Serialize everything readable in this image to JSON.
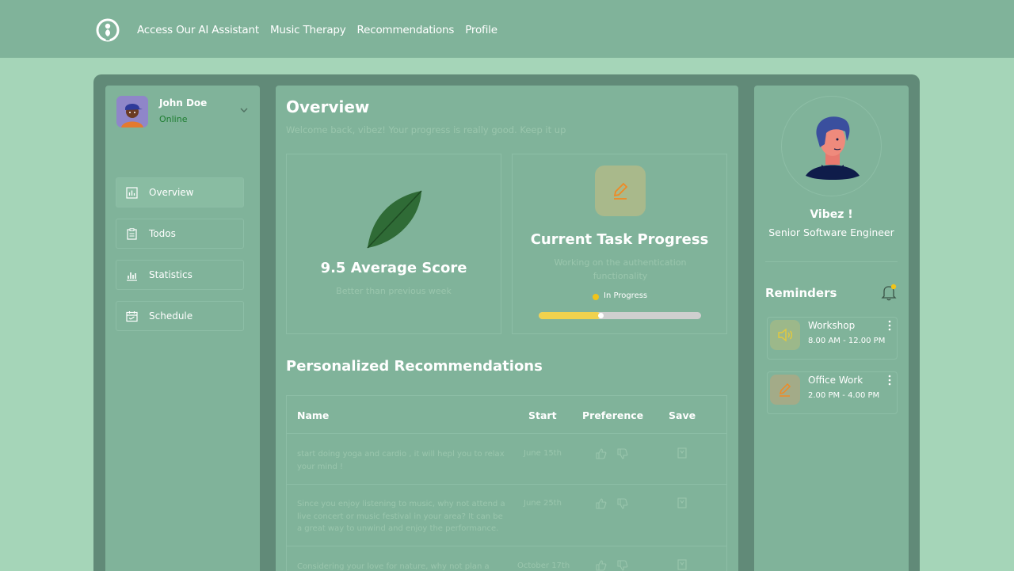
{
  "nav": {
    "logo_icon": "head-leaf-logo-icon",
    "links": [
      "Access Our AI Assistant",
      "Music Therapy",
      "Recommendations",
      "Profile"
    ]
  },
  "user": {
    "name": "John Doe",
    "status": "Online",
    "status_color": "#1e7d30"
  },
  "sidebar": {
    "items": [
      {
        "label": "Overview",
        "icon": "bar-chart-icon",
        "active": true
      },
      {
        "label": "Todos",
        "icon": "clipboard-icon",
        "active": false
      },
      {
        "label": "Statistics",
        "icon": "statistics-icon",
        "active": false
      },
      {
        "label": "Schedule",
        "icon": "calendar-icon",
        "active": false
      }
    ]
  },
  "overview": {
    "title": "Overview",
    "welcome": "Welcome back, vibez! Your progress is really good. Keep it up"
  },
  "score_card": {
    "title": "9.5 Average Score",
    "subtitle": "Better than previous week"
  },
  "task_card": {
    "title": "Current Task Progress",
    "subtitle": "Working on the authentication functionality",
    "status": "In Progress",
    "progress_percent": 38,
    "status_color": "#f0c419"
  },
  "recommendations": {
    "title": "Personalized Recommendations",
    "columns": [
      "Name",
      "Start",
      "Preference",
      "Save"
    ],
    "rows": [
      {
        "name": "start doing yoga and cardio , it will hepl you to relax your mind !",
        "start": "June 15th"
      },
      {
        "name": "Since you enjoy listening to music, why not attend a live concert or music festival in your area? It can be a great way to unwind and enjoy the performance.",
        "start": "June 25th"
      },
      {
        "name": "Considering your love for nature, why not plan a",
        "start": "October 17th"
      }
    ]
  },
  "profile": {
    "name": "Vibez !",
    "role": "Senior Software Engineer"
  },
  "reminders": {
    "title": "Reminders",
    "items": [
      {
        "title": "Workshop",
        "time": "8.00 AM - 12.00 PM",
        "icon": "speaker-icon"
      },
      {
        "title": "Office Work",
        "time": "2.00 PM - 4.00 PM",
        "icon": "pencil-icon"
      }
    ]
  },
  "colors": {
    "accent": "#f0c419",
    "panel": "#80b39a",
    "frame": "#618a78",
    "background": "#a5d5b8"
  }
}
